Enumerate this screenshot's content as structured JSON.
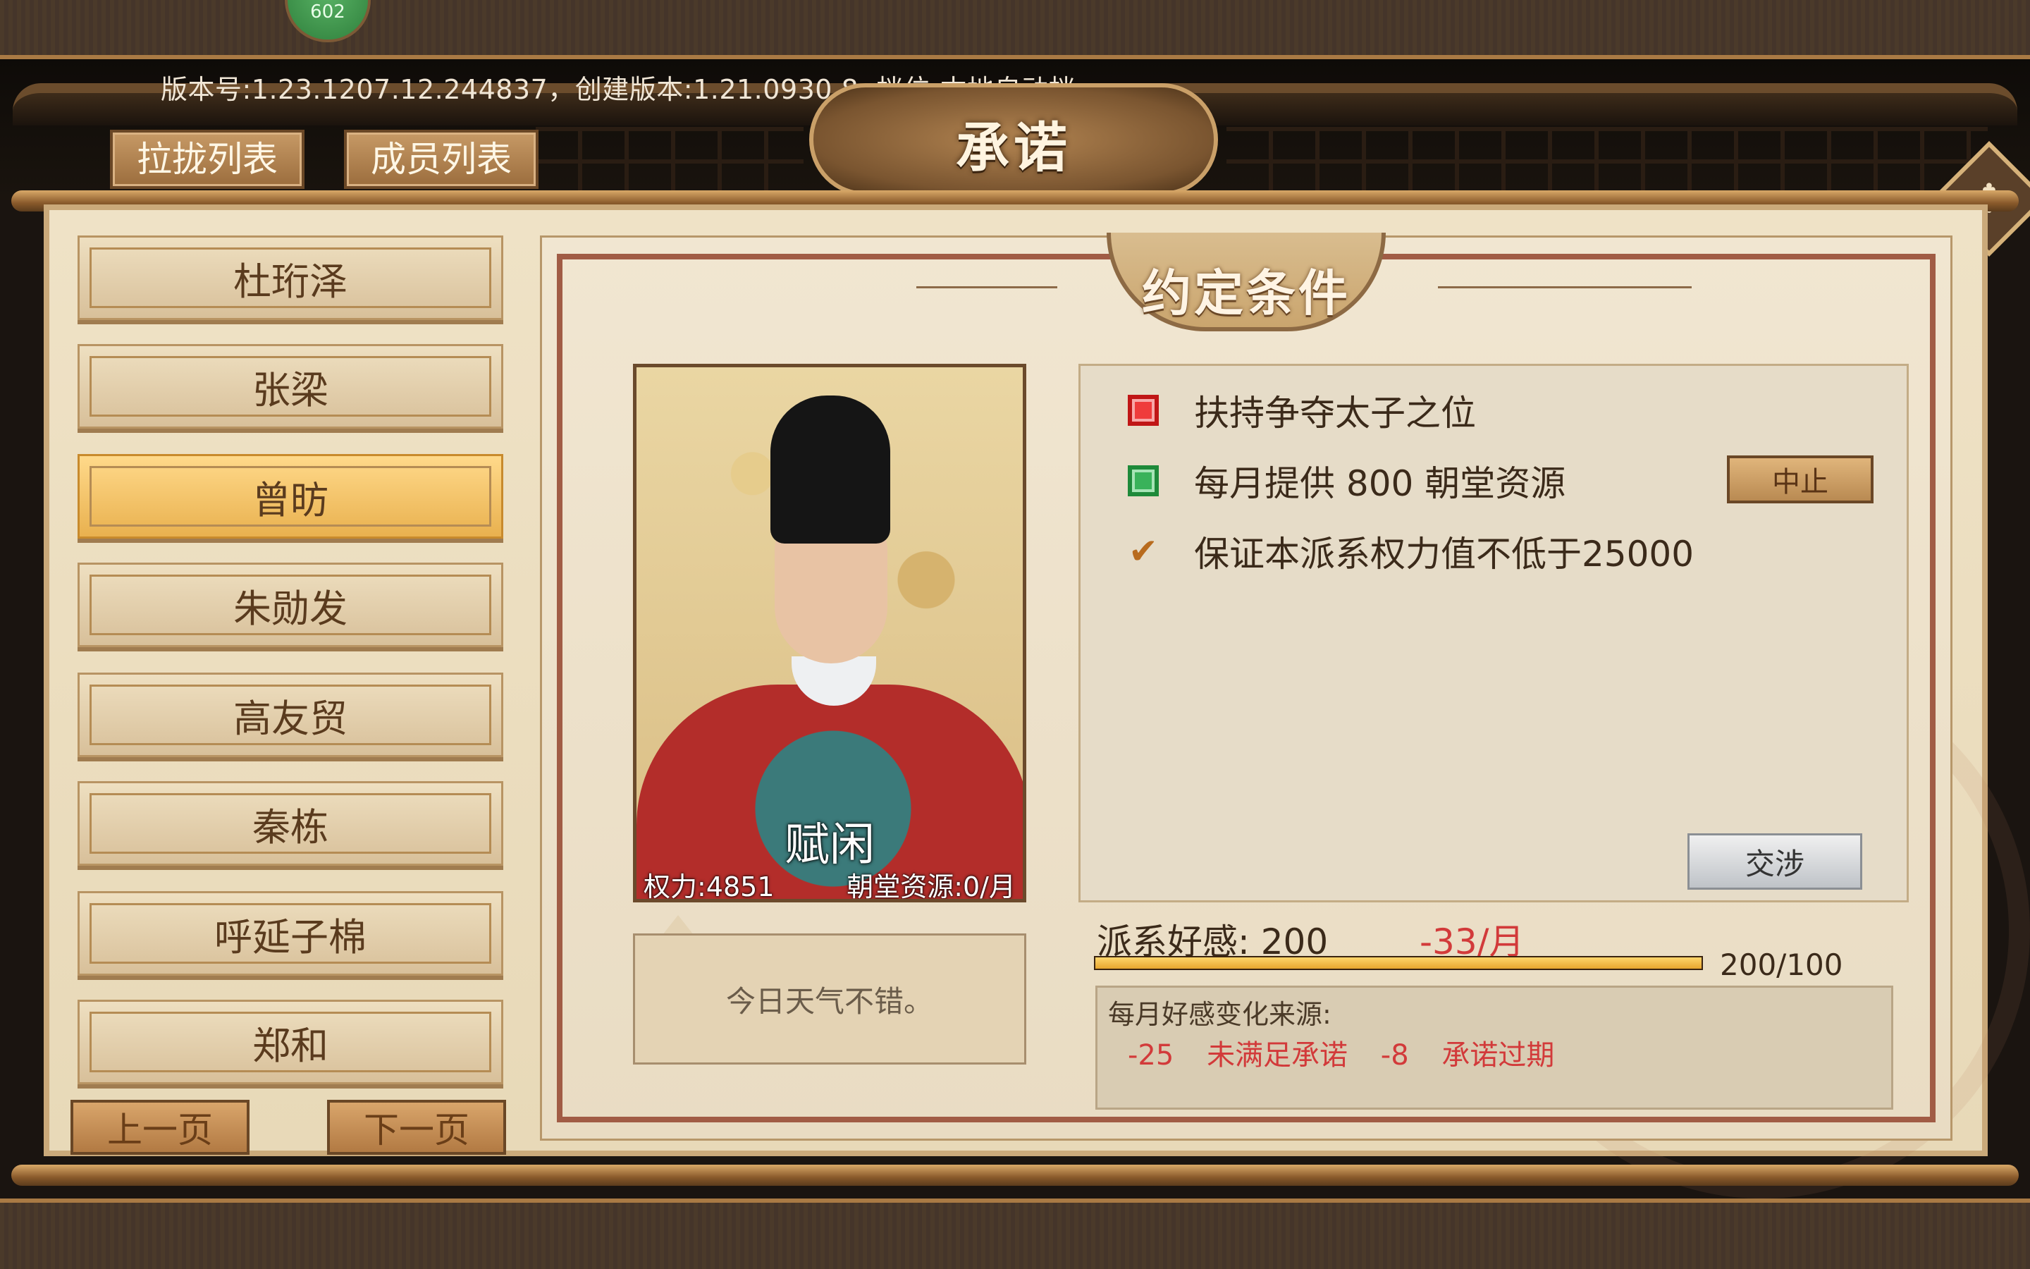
{
  "top_badge": "602",
  "version_text": "版本号:1.23.1207.12.244837，创建版本:1.21.0930.8, 档位:本地自动档",
  "tabs": [
    "拉拢列表",
    "成员列表"
  ],
  "title": "承诺",
  "close_glyph": "✥",
  "names": [
    "杜珩泽",
    "张梁",
    "曾昉",
    "朱勋发",
    "高友贸",
    "秦栋",
    "呼延子棉",
    "郑和"
  ],
  "selected_name": "曾昉",
  "pager": {
    "prev": "上一页",
    "next": "下一页"
  },
  "section_title": "约定条件",
  "portrait": {
    "name": "赋闲",
    "power": "权力:4851",
    "resource": "朝堂资源:0/月"
  },
  "speech": "今日天气不错。",
  "conditions": [
    {
      "status": "red",
      "text": "扶持争夺太子之位"
    },
    {
      "status": "green",
      "text": "每月提供 800 朝堂资源"
    },
    {
      "status": "check",
      "text": "保证本派系权力值不低于25000"
    }
  ],
  "stop_button": "中止",
  "negotiate_button": "交涉",
  "favor": {
    "label": "派系好感: 200",
    "rate": "-33/月",
    "total": "200/100",
    "fill_fraction": 1.0
  },
  "source": {
    "title": "每月好感变化来源:",
    "items": [
      "-25",
      "未满足承诺",
      "-8",
      "承诺过期"
    ]
  },
  "colors": {
    "selected_item": "#e9b14f",
    "negative": "#d23a3a",
    "frame": "#a15c45"
  }
}
